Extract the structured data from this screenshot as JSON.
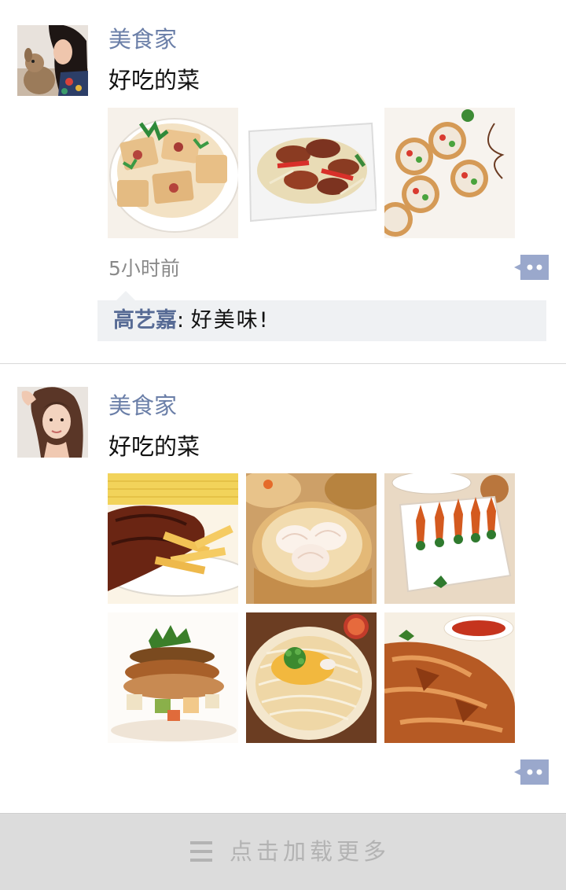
{
  "posts": [
    {
      "author": "美食家",
      "content": "好吃的菜",
      "avatar_icon": "avatar-photo-woman-with-plush-toy",
      "photos": [
        "tofu-dish-photo",
        "stir-fried-pork-photo",
        "tartlet-appetizer-photo"
      ],
      "time": "5小时前",
      "comment_icon": "comment-bubble-icon",
      "comments": [
        {
          "user": "高艺嘉",
          "separator": ":",
          "text": "好美味!"
        }
      ]
    },
    {
      "author": "美食家",
      "content": "好吃的菜",
      "avatar_icon": "avatar-photo-woman-portrait",
      "photos": [
        "bbq-ribs-fries-photo",
        "dim-sum-photo",
        "shrimp-appetizer-photo",
        "foie-gras-dish-photo",
        "noodle-soup-photo",
        "roast-duck-photo"
      ],
      "comment_icon": "comment-bubble-icon"
    }
  ],
  "load_more": {
    "icon": "menu-icon",
    "label": "点击加载更多"
  },
  "colors": {
    "author": "#6b7fa8",
    "comment_user": "#576b95",
    "comment_bg": "#eff1f3",
    "comment_icon": "#9aa8cc",
    "load_more_bg": "#dcdcdc",
    "load_more_text": "#b3b3b3"
  }
}
